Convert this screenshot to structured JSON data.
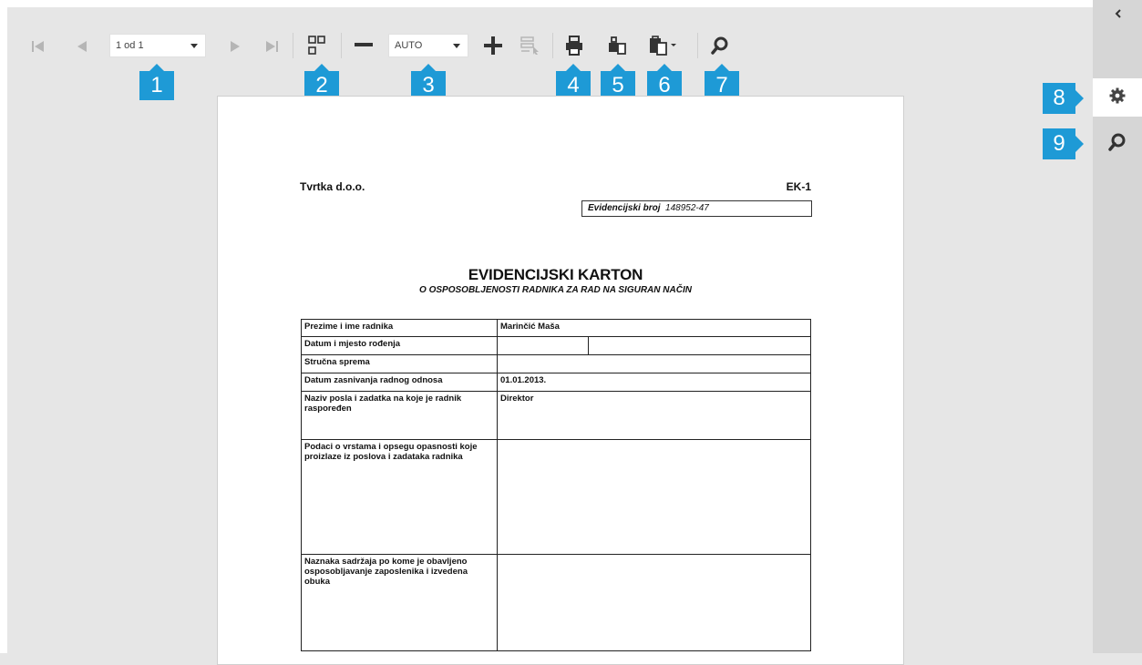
{
  "toolbar": {
    "page_select": "1 od 1",
    "zoom_select": "AUTO"
  },
  "badges": [
    "1",
    "2",
    "3",
    "4",
    "5",
    "6",
    "7",
    "8",
    "9"
  ],
  "icons": {
    "first": "first-page-icon",
    "prev": "previous-page-icon",
    "next": "next-page-icon",
    "last": "last-page-icon",
    "view_mode": "view-mode-icon",
    "zoom_out": "zoom-out-icon",
    "zoom_in": "zoom-in-icon",
    "select": "select-tool-icon",
    "print": "print-icon",
    "export": "export-icon",
    "save": "save-icon",
    "search": "search-icon",
    "settings": "gear-icon",
    "side_search": "search-icon",
    "collapse": "chevron-left-icon"
  },
  "colors": {
    "badge": "#1e9ad6",
    "toolbar_bg": "#e6e6e6",
    "side_panel": "#d6d6d6"
  },
  "document": {
    "company": "Tvrtka d.o.o.",
    "form_code": "EK-1",
    "evidence_label": "Evidencijski broj",
    "evidence_number": "148952-47",
    "title": "EVIDENCIJSKI KARTON",
    "subtitle": "O OSPOSOBLJENOSTI RADNIKA ZA RAD NA SIGURAN NAČIN",
    "rows": [
      {
        "label": "Prezime i ime radnika",
        "value": "Marinčić Maša"
      },
      {
        "label": "Datum i mjesto rođenja",
        "value": ""
      },
      {
        "label": "Stručna sprema",
        "value": ""
      },
      {
        "label": "Datum zasnivanja radnog odnosa",
        "value": "01.01.2013."
      },
      {
        "label": "Naziv posla i zadatka na koje je radnik raspoređen",
        "value": "Direktor"
      },
      {
        "label": "Podaci o vrstama i opsegu opasnosti koje proizlaze iz poslova i zadataka radnika",
        "value": ""
      },
      {
        "label": "Naznaka sadržaja po kome je obavljeno osposobljavanje zaposlenika i izvedena obuka",
        "value": ""
      }
    ]
  }
}
